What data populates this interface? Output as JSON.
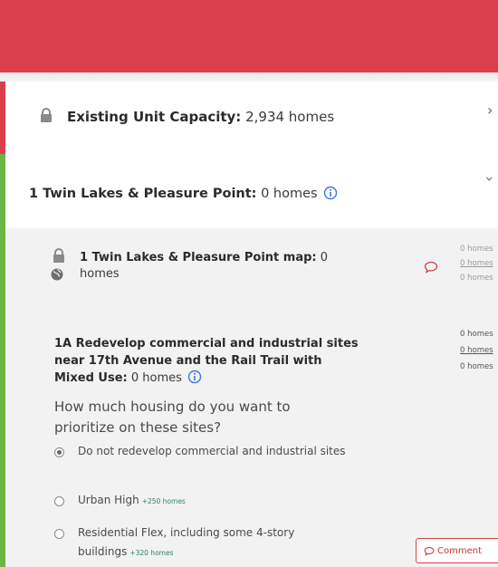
{
  "colors": {
    "accent_red": "#dc3f4c",
    "accent_green": "#6ab643",
    "info_blue": "#3a7bd5"
  },
  "existing": {
    "label": "Existing Unit Capacity:",
    "value": "2,934 homes",
    "icon": "lock-icon"
  },
  "twin_lakes": {
    "label": "1 Twin Lakes & Pleasure Point:",
    "value": "0 homes"
  },
  "map_row": {
    "label": "1 Twin Lakes & Pleasure Point map:",
    "value": "0 homes",
    "side_counts": [
      "0 homes",
      "0 homes",
      "0 homes"
    ]
  },
  "option_1a": {
    "label": "1A Redevelop commercial and industrial sites near 17th Avenue and the Rail Trail with Mixed Use:",
    "value": "0 homes",
    "side_counts": [
      "0 homes",
      "0 homes",
      "0 homes"
    ],
    "question": "How much housing do you want to prioritize on these sites?",
    "choices": [
      {
        "label": "Do not redevelop commercial and industrial sites",
        "count": "",
        "checked": true
      },
      {
        "label": "Urban High",
        "count": "+250 homes",
        "checked": false
      },
      {
        "label": "Residential Flex, including some 4-story buildings",
        "count": "+320 homes",
        "checked": false
      }
    ]
  },
  "comment_button": {
    "label": "Comment"
  }
}
